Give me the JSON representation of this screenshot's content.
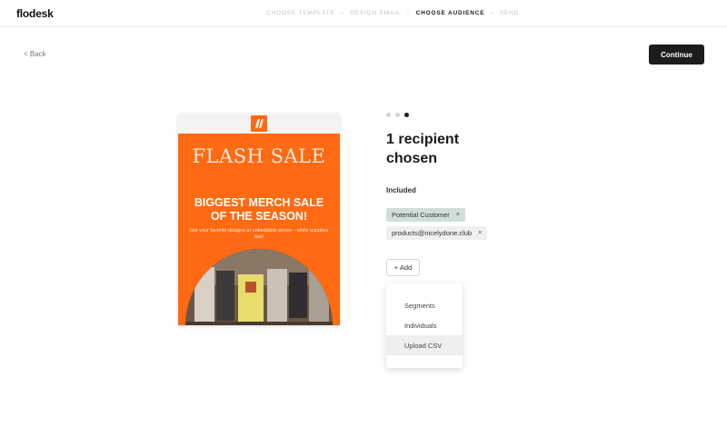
{
  "app": {
    "logo": "flodesk"
  },
  "steps": [
    {
      "label": "CHOOSE TEMPLATE",
      "active": false
    },
    {
      "label": "DESIGN EMAIL",
      "active": false
    },
    {
      "label": "CHOOSE AUDIENCE",
      "active": true
    },
    {
      "label": "SEND",
      "active": false
    }
  ],
  "step_separator": "•",
  "nav": {
    "back_label": "< Back",
    "continue_label": "Continue"
  },
  "preview": {
    "title": "FLASH SALE",
    "headline": "BIGGEST MERCH SALE OF THE SEASON!",
    "subtext": "Get your favorite designs at unbeatable prices – while supplies last!"
  },
  "pager": {
    "count": 3,
    "active_index": 2
  },
  "audience": {
    "heading": "1 recipient chosen",
    "included_label": "Included",
    "chips": [
      {
        "label": "Potential Customer",
        "remove": "×"
      },
      {
        "label": "products@nicelydone.club",
        "remove": "×"
      }
    ],
    "add_label": "+ Add",
    "menu": [
      "Segments",
      "Individuals",
      "Upload CSV"
    ]
  },
  "colors": {
    "accent": "#ff6a13",
    "primary_button": "#1c1c1c",
    "segment_chip": "#cfdfd8",
    "email_chip": "#efefef"
  }
}
